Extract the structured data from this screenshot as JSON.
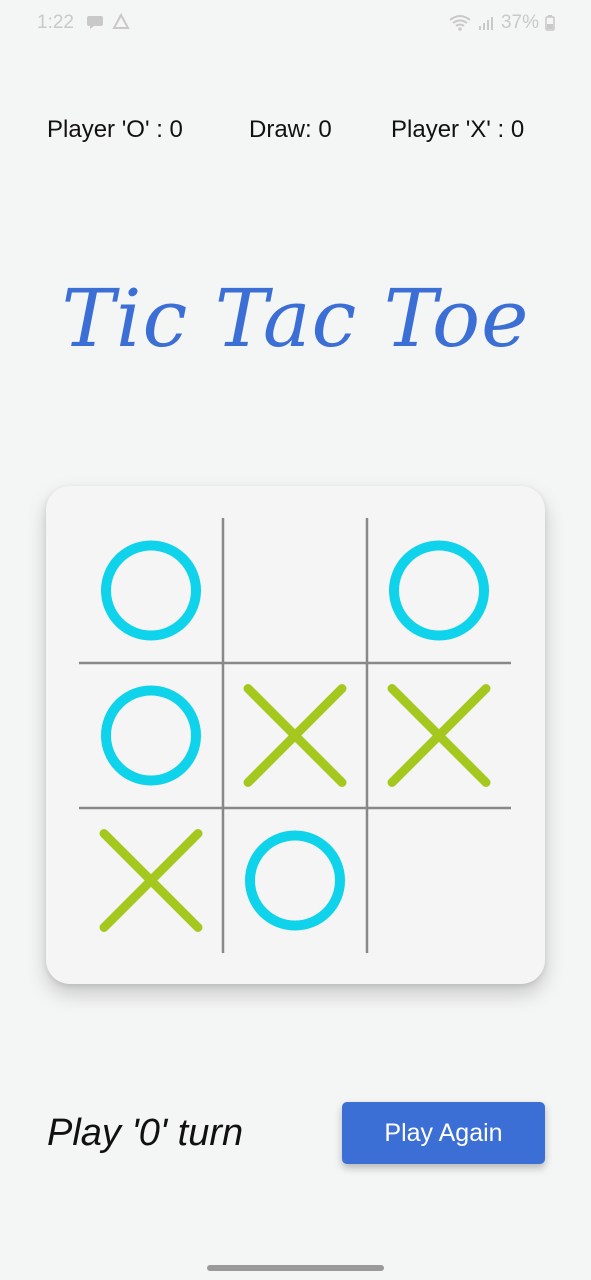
{
  "status_bar": {
    "time": "1:22",
    "battery": "37%",
    "icons": [
      "chat-icon",
      "alert-icon",
      "wifi-icon",
      "signal-icon",
      "battery-icon"
    ]
  },
  "scores": {
    "player_o": "Player 'O' : 0",
    "draw": "Draw: 0",
    "player_x": "Player 'X' : 0"
  },
  "title": "Tic Tac Toe",
  "board": {
    "cells": [
      "O",
      "",
      "O",
      "O",
      "X",
      "X",
      "X",
      "O",
      ""
    ],
    "colors": {
      "o": "#0fd3ea",
      "x": "#a5c81f",
      "grid": "#888888"
    }
  },
  "turn_text": "Play '0' turn",
  "play_again_label": "Play Again",
  "colors": {
    "accent": "#3b6fd6",
    "background": "#f4f5f5"
  }
}
